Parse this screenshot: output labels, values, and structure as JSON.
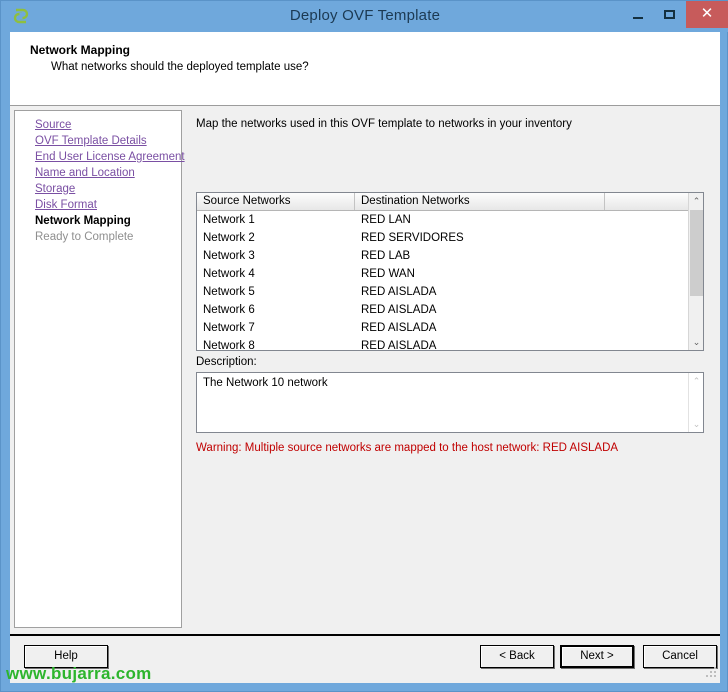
{
  "window": {
    "title": "Deploy OVF Template",
    "app_icon": "vmware-ovf-icon",
    "controls": {
      "minimize": "–",
      "maximize": "□",
      "close": "✕"
    },
    "colors": {
      "titlebar": "#6fa8dc",
      "close_button": "#c75b5b",
      "link": "#7a4fa3",
      "warning": "#c00000",
      "watermark": "#2db52d"
    }
  },
  "header": {
    "title": "Network Mapping",
    "subtitle": "What networks should the deployed template use?"
  },
  "sidebar": {
    "items": [
      {
        "label": "Source",
        "state": "link"
      },
      {
        "label": "OVF Template Details",
        "state": "link"
      },
      {
        "label": "End User License Agreement",
        "state": "link"
      },
      {
        "label": "Name and Location",
        "state": "link"
      },
      {
        "label": "Storage",
        "state": "link"
      },
      {
        "label": "Disk Format",
        "state": "link"
      },
      {
        "label": "Network Mapping",
        "state": "current"
      },
      {
        "label": "Ready to Complete",
        "state": "future"
      }
    ]
  },
  "main": {
    "intro": "Map the networks used in this OVF template to networks in your inventory",
    "table": {
      "columns": [
        "Source Networks",
        "Destination Networks",
        ""
      ],
      "rows": [
        {
          "source": "Network 1",
          "destination": "RED LAN"
        },
        {
          "source": "Network 2",
          "destination": "RED SERVIDORES"
        },
        {
          "source": "Network 3",
          "destination": "RED LAB"
        },
        {
          "source": "Network 4",
          "destination": "RED WAN"
        },
        {
          "source": "Network 5",
          "destination": "RED AISLADA"
        },
        {
          "source": "Network 6",
          "destination": "RED AISLADA"
        },
        {
          "source": "Network 7",
          "destination": "RED AISLADA"
        },
        {
          "source": "Network 8",
          "destination": "RED AISLADA"
        }
      ]
    },
    "description_label": "Description:",
    "description_text": "The Network 10 network",
    "warning": "Warning: Multiple source networks are mapped to the host network: RED AISLADA",
    "scroll_arrows": {
      "up": "⌃",
      "down": "⌄"
    }
  },
  "footer": {
    "help": "Help",
    "back": "< Back",
    "next": "Next >",
    "cancel": "Cancel"
  },
  "watermark": "www.bujarra.com"
}
